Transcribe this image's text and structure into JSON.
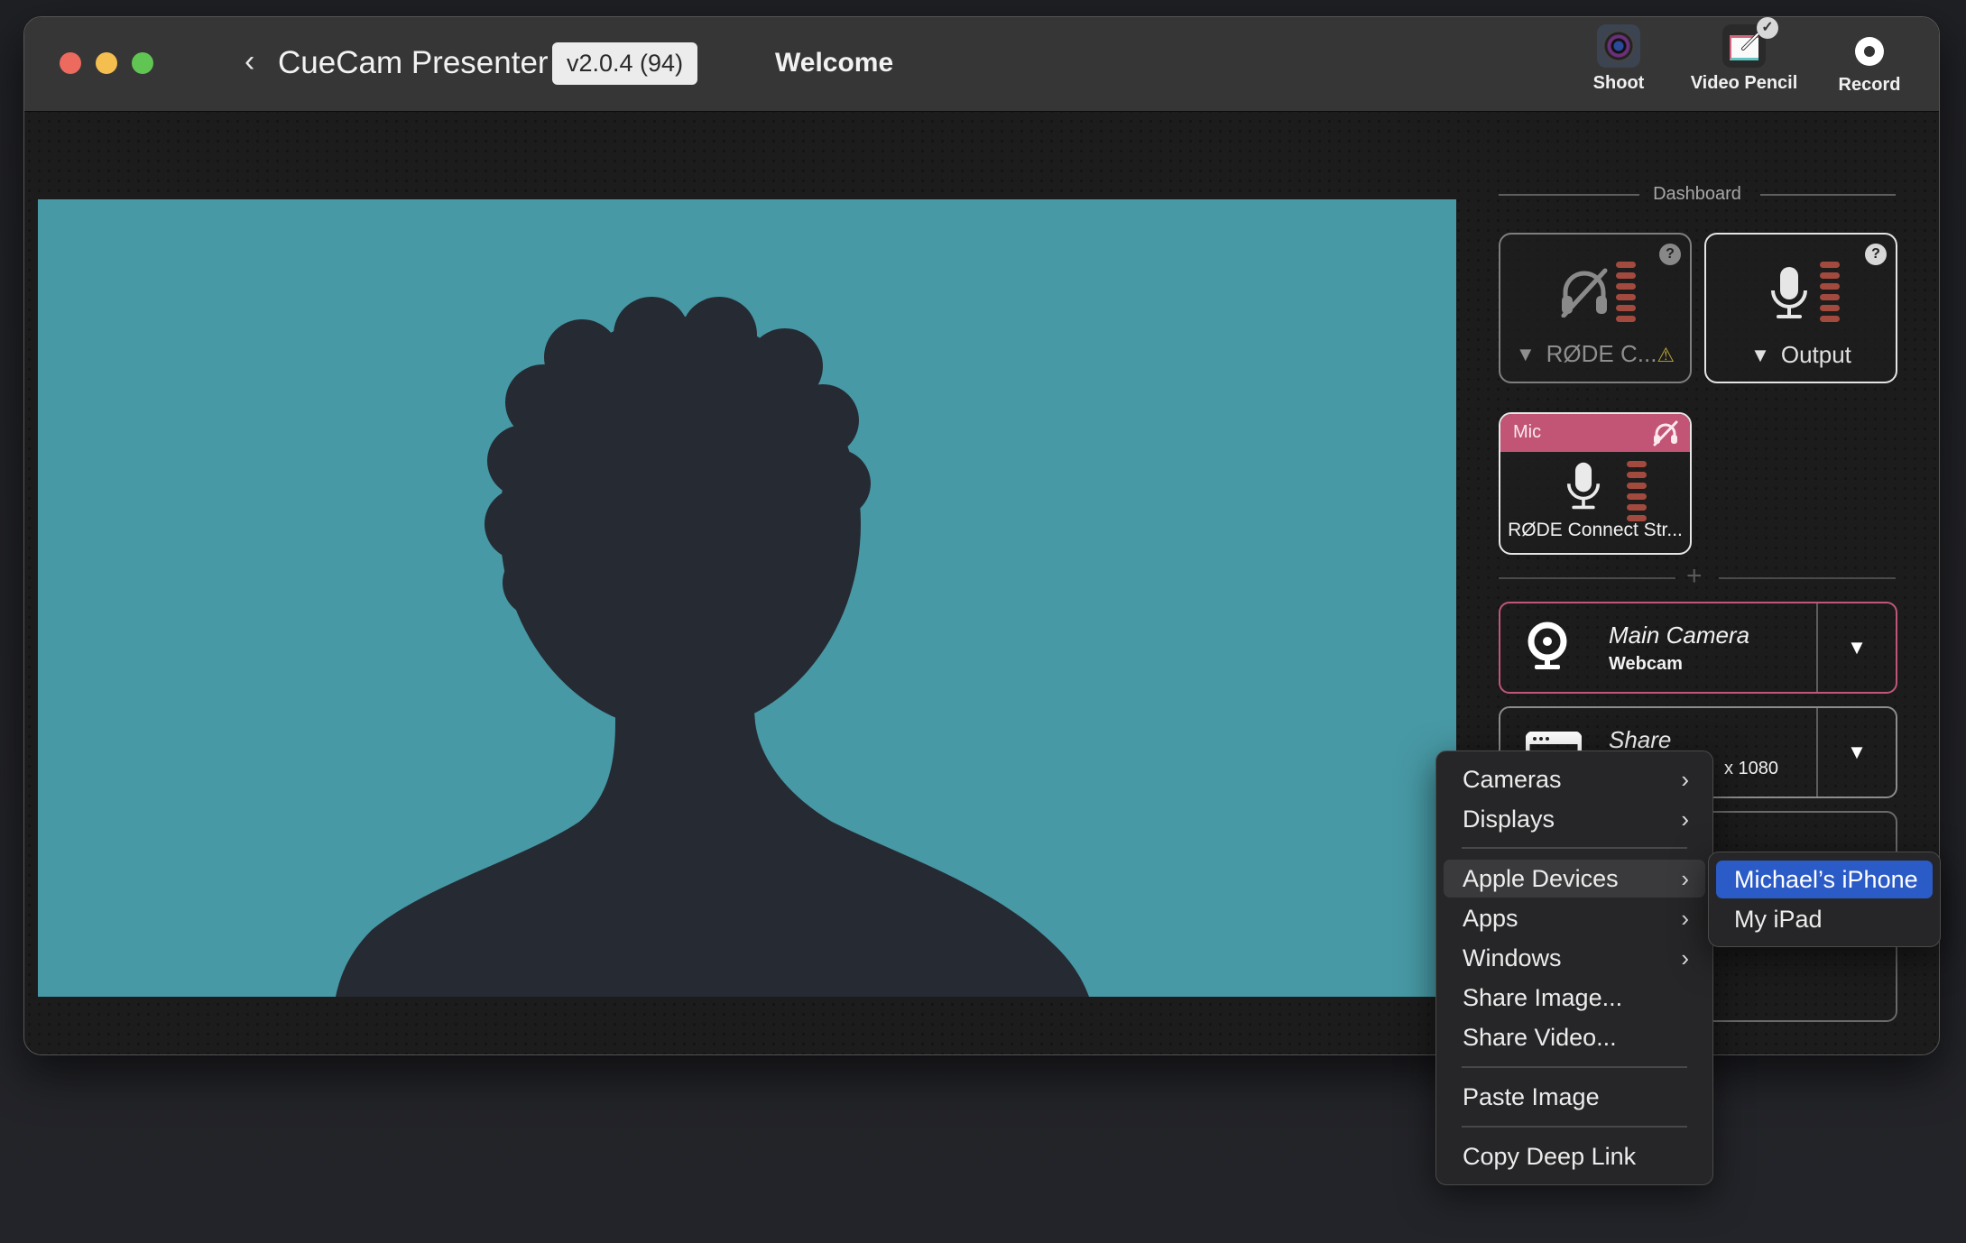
{
  "window": {
    "app_title": "CueCam Presenter",
    "version": "v2.0.4 (94)",
    "page_title": "Welcome",
    "traffic_lights": {
      "close": "#ec6a5e",
      "minimize": "#f4bf4f",
      "maximize": "#61c554"
    }
  },
  "toolbar": {
    "items": [
      {
        "label": "Shoot",
        "icon": "camera-lens-icon"
      },
      {
        "label": "Video Pencil",
        "icon": "video-pencil-icon",
        "badge": "checkmark"
      },
      {
        "label": "Record",
        "icon": "record-icon"
      }
    ]
  },
  "preview": {
    "background_color": "#4799a5",
    "silhouette_color": "#262a33",
    "content": "person-silhouette-placeholder"
  },
  "dashboard": {
    "title": "Dashboard",
    "audio_cards": [
      {
        "name": "RØDE C...",
        "icon": "headphones-muted-icon",
        "help": "?",
        "warning": "⚠",
        "state": "inactive"
      },
      {
        "name": "Output",
        "icon": "microphone-icon",
        "help": "?",
        "state": "active"
      }
    ],
    "mic_card": {
      "header": "Mic",
      "header_icon": "headphones-muted-icon",
      "name": "RØDE Connect Str...",
      "header_color": "#c25576"
    },
    "add_symbol": "+",
    "sources": [
      {
        "title": "Main Camera",
        "subtitle": "Webcam",
        "icon": "webcam-icon",
        "selected": true
      },
      {
        "title": "Share",
        "subtitle": "x 1080",
        "icon": "browser-window-icon",
        "selected": false
      },
      {
        "title": "",
        "subtitle": "",
        "icon": "",
        "selected": false
      }
    ]
  },
  "context_menu": {
    "items": [
      {
        "label": "Cameras",
        "submenu": true
      },
      {
        "label": "Displays",
        "submenu": true
      },
      {
        "label": "Apple Devices",
        "submenu": true,
        "active": true
      },
      {
        "label": "Apps",
        "submenu": true
      },
      {
        "label": "Windows",
        "submenu": true
      },
      {
        "label": "Share Image...",
        "submenu": false
      },
      {
        "label": "Share Video...",
        "submenu": false
      },
      {
        "label": "Paste Image",
        "submenu": false
      },
      {
        "label": "Copy Deep Link",
        "submenu": false
      }
    ],
    "submenu": {
      "items": [
        {
          "label": "Michael’s iPhone",
          "selected": true
        },
        {
          "label": "My iPad",
          "selected": false
        }
      ],
      "highlight_color": "#2a5bc6"
    }
  }
}
